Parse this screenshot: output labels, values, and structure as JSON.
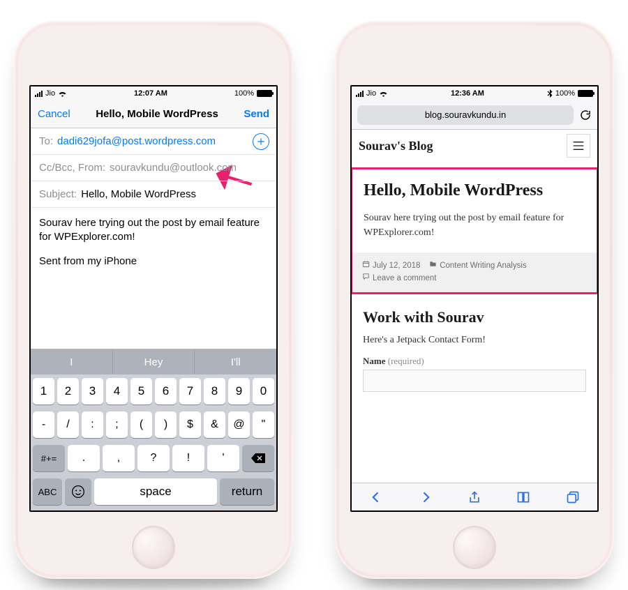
{
  "left": {
    "status": {
      "carrier": "Jio",
      "time": "12:07 AM",
      "battery": "100%"
    },
    "nav": {
      "cancel": "Cancel",
      "title": "Hello, Mobile WordPress",
      "send": "Send"
    },
    "to": {
      "label": "To:",
      "value": "dadi629jofa@post.wordpress.com"
    },
    "ccbcc": {
      "label": "Cc/Bcc, From:",
      "value": "souravkundu@outlook.com"
    },
    "subject": {
      "label": "Subject:",
      "value": "Hello, Mobile WordPress"
    },
    "bodyLine1": "Sourav here trying out the post by email feature for WPExplorer.com!",
    "bodyLine2": "Sent from my iPhone",
    "predictions": {
      "p1": "I",
      "p2": "Hey",
      "p3": "I'll"
    },
    "keys": {
      "r1": [
        "1",
        "2",
        "3",
        "4",
        "5",
        "6",
        "7",
        "8",
        "9",
        "0"
      ],
      "r2": [
        "-",
        "/",
        ":",
        ";",
        "(",
        ")",
        "$",
        "&",
        "@",
        "\""
      ],
      "r3": {
        "sym": "#+=",
        "mid": [
          ".",
          ",",
          "?",
          "!",
          "'"
        ],
        "del": "⌫"
      },
      "r4": {
        "abc": "ABC",
        "space": "space",
        "ret": "return"
      }
    }
  },
  "right": {
    "status": {
      "carrier": "Jio",
      "time": "12:36 AM",
      "battery": "100%",
      "bluetooth": true
    },
    "url": "blog.souravkundu.in",
    "blogTitle": "Sourav's Blog",
    "post": {
      "title": "Hello, Mobile WordPress",
      "body": "Sourav here trying out the post by email feature for WPExplorer.com!",
      "date": "July 12, 2018",
      "category": "Content Writing Analysis",
      "comments": "Leave a comment"
    },
    "section": {
      "title": "Work with Sourav",
      "body": "Here's a Jetpack Contact Form!",
      "fieldLabel": "Name",
      "fieldReq": "(required)"
    }
  }
}
